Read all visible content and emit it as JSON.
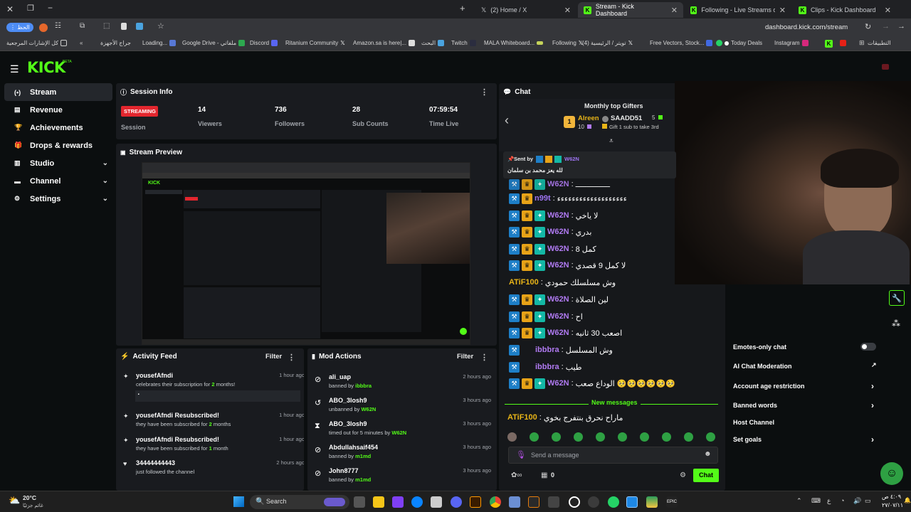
{
  "browser": {
    "tabs": [
      {
        "label": "(2) Home / X",
        "icon": "x-logo-icon"
      },
      {
        "label": "Stream - Kick Dashboard",
        "icon": "kick-icon"
      },
      {
        "label": "Following - Live Streams on Ki",
        "icon": "kick-icon"
      },
      {
        "label": "Clips - Kick Dashboard",
        "icon": "kick-icon"
      }
    ],
    "profile_label": "الحظ",
    "url": "dashboard.kick.com/stream",
    "bookmarks": [
      "كل الإشارات المرجعية",
      "جراج الأجهزة",
      "Loading...",
      "Google Drive - ملفاتي",
      "Discord",
      "Ritanium Community",
      "Amazon.sa is here|...",
      "البحث",
      "Twitch",
      "MALA Whiteboard...",
      "Following",
      "تويتر / الرئيسية (4)",
      "Free Vectors, Stock...",
      "Today Deals",
      "Instagram",
      "التطبيقات"
    ]
  },
  "app": {
    "logo": "KICK",
    "logo_badge": "BETA",
    "sidebar": [
      {
        "label": "Stream",
        "icon": "stream-icon",
        "active": true,
        "chevron": false
      },
      {
        "label": "Revenue",
        "icon": "revenue-icon",
        "active": false,
        "chevron": false
      },
      {
        "label": "Achievements",
        "icon": "trophy-icon",
        "active": false,
        "chevron": false
      },
      {
        "label": "Drops & rewards",
        "icon": "gift-icon",
        "active": false,
        "chevron": false
      },
      {
        "label": "Studio",
        "icon": "studio-icon",
        "active": false,
        "chevron": true
      },
      {
        "label": "Channel",
        "icon": "channel-icon",
        "active": false,
        "chevron": true
      },
      {
        "label": "Settings",
        "icon": "gear-icon",
        "active": false,
        "chevron": true
      }
    ]
  },
  "session": {
    "title": "Session Info",
    "status_badge": "STREAMING",
    "session_label": "Session",
    "stats": [
      {
        "value": "14",
        "label": "Viewers"
      },
      {
        "value": "736",
        "label": "Followers"
      },
      {
        "value": "28",
        "label": "Sub Counts"
      },
      {
        "value": "07:59:54",
        "label": "Time Live"
      }
    ]
  },
  "preview": {
    "title": "Stream Preview"
  },
  "activity": {
    "title": "Activity Feed",
    "filter": "Filter",
    "items": [
      {
        "title": "yousefAfndi",
        "sub_pre": "celebrates their subscription for ",
        "sub_num": "2",
        "sub_post": " months!",
        "time": "1 hour ago",
        "message": "ٔٔٔٔٔٔٔٔٔٔٔٔٔٔٔٔٔٔٔٔٔٔٔٔٔٔٔٔٔٔٔٔٔٔٔٔٔٔٔٔٔٔٔٔٔٔٔٔ",
        "icon": "sparkle-icon"
      },
      {
        "title": "yousefAfndi Resubscribed!",
        "sub_pre": "they have been subscribed for ",
        "sub_num": "2",
        "sub_post": " months",
        "time": "1 hour ago",
        "icon": "sparkle-icon"
      },
      {
        "title": "yousefAfndi Resubscribed!",
        "sub_pre": "they have been subscribed for ",
        "sub_num": "1",
        "sub_post": " month",
        "time": "1 hour ago",
        "icon": "sparkle-icon"
      },
      {
        "title": "34444444443",
        "sub_pre": "just followed the channel",
        "sub_num": "",
        "sub_post": "",
        "time": "2 hours ago",
        "icon": "heart-icon"
      }
    ]
  },
  "mod_actions": {
    "title": "Mod Actions",
    "filter": "Filter",
    "items": [
      {
        "user": "ali_uap",
        "action": "banned by ",
        "by": "ibbbra",
        "time": "2 hours ago",
        "icon": "ban-icon"
      },
      {
        "user": "ABO_3losh9",
        "action": "unbanned by ",
        "by": "W62N",
        "time": "3 hours ago",
        "icon": "undo-icon"
      },
      {
        "user": "ABO_3losh9",
        "action": "timed out for 5 minutes by ",
        "by": "W62N",
        "time": "3 hours ago",
        "icon": "hourglass-icon"
      },
      {
        "user": "Abdullahsaif454",
        "action": "banned by ",
        "by": "m1md",
        "time": "3 hours ago",
        "icon": "ban-icon"
      },
      {
        "user": "John8777",
        "action": "banned by ",
        "by": "m1md",
        "time": "3 hours ago",
        "icon": "ban-icon"
      }
    ]
  },
  "chat": {
    "title": "Chat",
    "gifters_title": "Monthly top Gifters",
    "gifter1": {
      "name": "Alreen",
      "count": "10",
      "rank": "1"
    },
    "gifter2": {
      "name": "SAADD51",
      "count": "5"
    },
    "gift_cta": "Gift 1 sub to take 3rd",
    "pinned_label": "Sent by",
    "pinned_user": "W62N",
    "pinned_msg": "لله يعز محمد بن سلمان",
    "messages": [
      {
        "user": "W62N",
        "text": "ـــــــــــــــ",
        "badges": [
          "blue",
          "gold",
          "teal"
        ],
        "color": "p"
      },
      {
        "user": "n99t",
        "text": "ءءءءءءءءءءءءءءءءءءء",
        "badges": [
          "blue",
          "gold"
        ],
        "color": "w"
      },
      {
        "user": "W62N",
        "text": "لا ياخي",
        "badges": [
          "blue",
          "gold",
          "teal"
        ],
        "color": "p"
      },
      {
        "user": "W62N",
        "text": "بدري",
        "badges": [
          "blue",
          "gold",
          "teal"
        ],
        "color": "p"
      },
      {
        "user": "W62N",
        "text": "كمل 8",
        "badges": [
          "blue",
          "gold",
          "teal"
        ],
        "color": "p"
      },
      {
        "user": "W62N",
        "text": "لا كمل 9 قصدي",
        "badges": [
          "blue",
          "gold",
          "teal"
        ],
        "color": "p"
      },
      {
        "user": "ATiF100",
        "text": "وش مسلسلك حمودي",
        "badges": [],
        "color": "y"
      },
      {
        "user": "W62N",
        "text": "لين الصلاة",
        "badges": [
          "blue",
          "gold",
          "teal"
        ],
        "color": "p"
      },
      {
        "user": "W62N",
        "text": "اح",
        "badges": [
          "blue",
          "gold",
          "teal"
        ],
        "color": "p"
      },
      {
        "user": "W62N",
        "text": "اصعب 30 ثانيه",
        "badges": [
          "blue",
          "gold",
          "teal"
        ],
        "color": "p"
      },
      {
        "user": "ibbbra",
        "text": "وش المسلسل",
        "badges": [
          "blue"
        ],
        "color": "p"
      },
      {
        "user": "ibbbra",
        "text": "طيب",
        "badges": [
          "blue"
        ],
        "color": "p"
      },
      {
        "user": "W62N",
        "text": "الوداع صعب 🥺🥺🥺🥺🥺🥺",
        "badges": [
          "blue",
          "gold",
          "teal"
        ],
        "color": "p"
      }
    ],
    "new_messages": "New messages",
    "last_msg": {
      "user": "ATiF100",
      "text": "ماراح نحرق بنتفرج بخوي"
    },
    "input_placeholder": "Send a message",
    "counter1": "0",
    "send_button": "Chat"
  },
  "chat_settings": [
    {
      "label": "Emotes-only chat",
      "type": "toggle"
    },
    {
      "label": "AI Chat Moderation",
      "type": "link"
    },
    {
      "label": "Account age restriction",
      "type": "arrow"
    },
    {
      "label": "Banned words",
      "type": "arrow"
    },
    {
      "label": "Host Channel",
      "type": "none"
    },
    {
      "label": "Set goals",
      "type": "arrow"
    }
  ],
  "taskbar": {
    "weather_temp": "20°C",
    "weather_desc": "غائم جزئيًا",
    "search": "Search",
    "lang": "ع",
    "time": "٤:٠٩ ص",
    "date": "٢٧/٠٧/١١"
  },
  "colors": {
    "accent": "#53fc18",
    "streaming": "#e3262e",
    "username": "#9e74f2",
    "gold": "#e8b417"
  }
}
